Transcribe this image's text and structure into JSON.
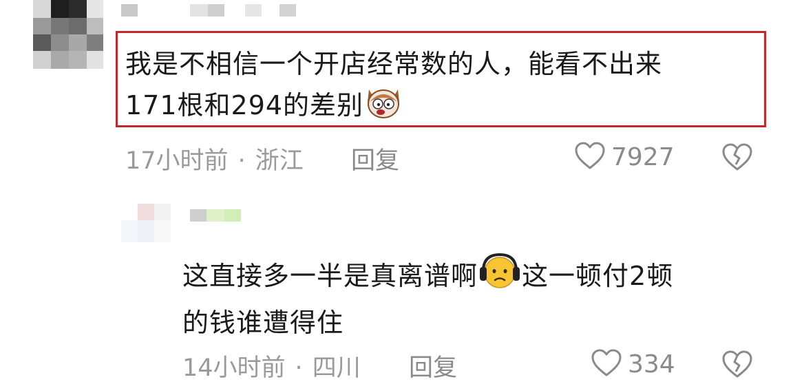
{
  "comments": [
    {
      "text_line1": "我是不相信一个开店经常数的人，能看不出来",
      "text_line2": "171根和294的差别",
      "emoji": "surprised-dog-emoji",
      "time": "17小时前",
      "location": "浙江",
      "reply_label": "回复",
      "likes": "7927",
      "highlight_color": "#c8262d"
    },
    {
      "text_line1_a": "这直接多一半是真离谱啊",
      "emoji": "headphone-sad-emoji",
      "text_line1_b": "这一顿付2顿",
      "text_line2": "的钱谁遭得住",
      "time": "14小时前",
      "location": "四川",
      "reply_label": "回复",
      "likes": "334"
    }
  ],
  "separator": "·",
  "icons": {
    "like": "heart-outline-icon",
    "dislike": "broken-heart-icon"
  },
  "colors": {
    "text": "#1a1a1a",
    "meta": "#9a9a9a",
    "highlight": "#c8262d"
  }
}
